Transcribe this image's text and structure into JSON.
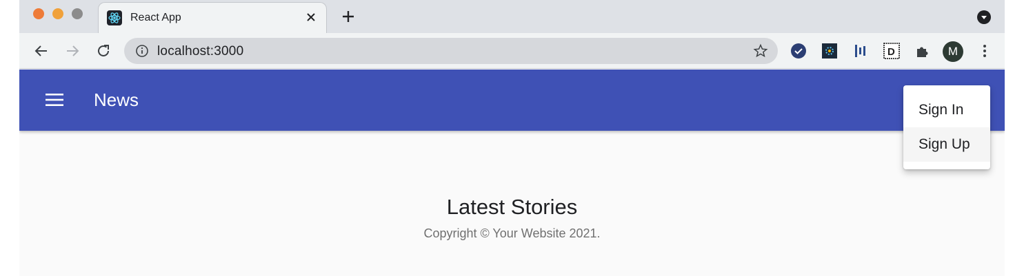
{
  "browser": {
    "tab_title": "React App",
    "url": "localhost:3000",
    "avatar_letter": "M"
  },
  "app": {
    "title": "News"
  },
  "menu": {
    "items": [
      {
        "label": "Sign In"
      },
      {
        "label": "Sign Up"
      }
    ]
  },
  "footer": {
    "title": "Latest Stories",
    "copyright": "Copyright © Your Website 2021."
  },
  "colors": {
    "appbar": "#3f51b5",
    "traffic_red": "#ee7b38",
    "traffic_yellow": "#f0a13a",
    "traffic_gray": "#8c8c8c"
  },
  "icons": [
    "react-logo-icon",
    "close-icon",
    "plus-icon",
    "tab-search-icon",
    "back-icon",
    "forward-icon",
    "reload-icon",
    "info-icon",
    "star-icon",
    "todo-check-icon",
    "extension-icon",
    "puzzle-icon",
    "kebab-menu-icon",
    "hamburger-icon"
  ]
}
